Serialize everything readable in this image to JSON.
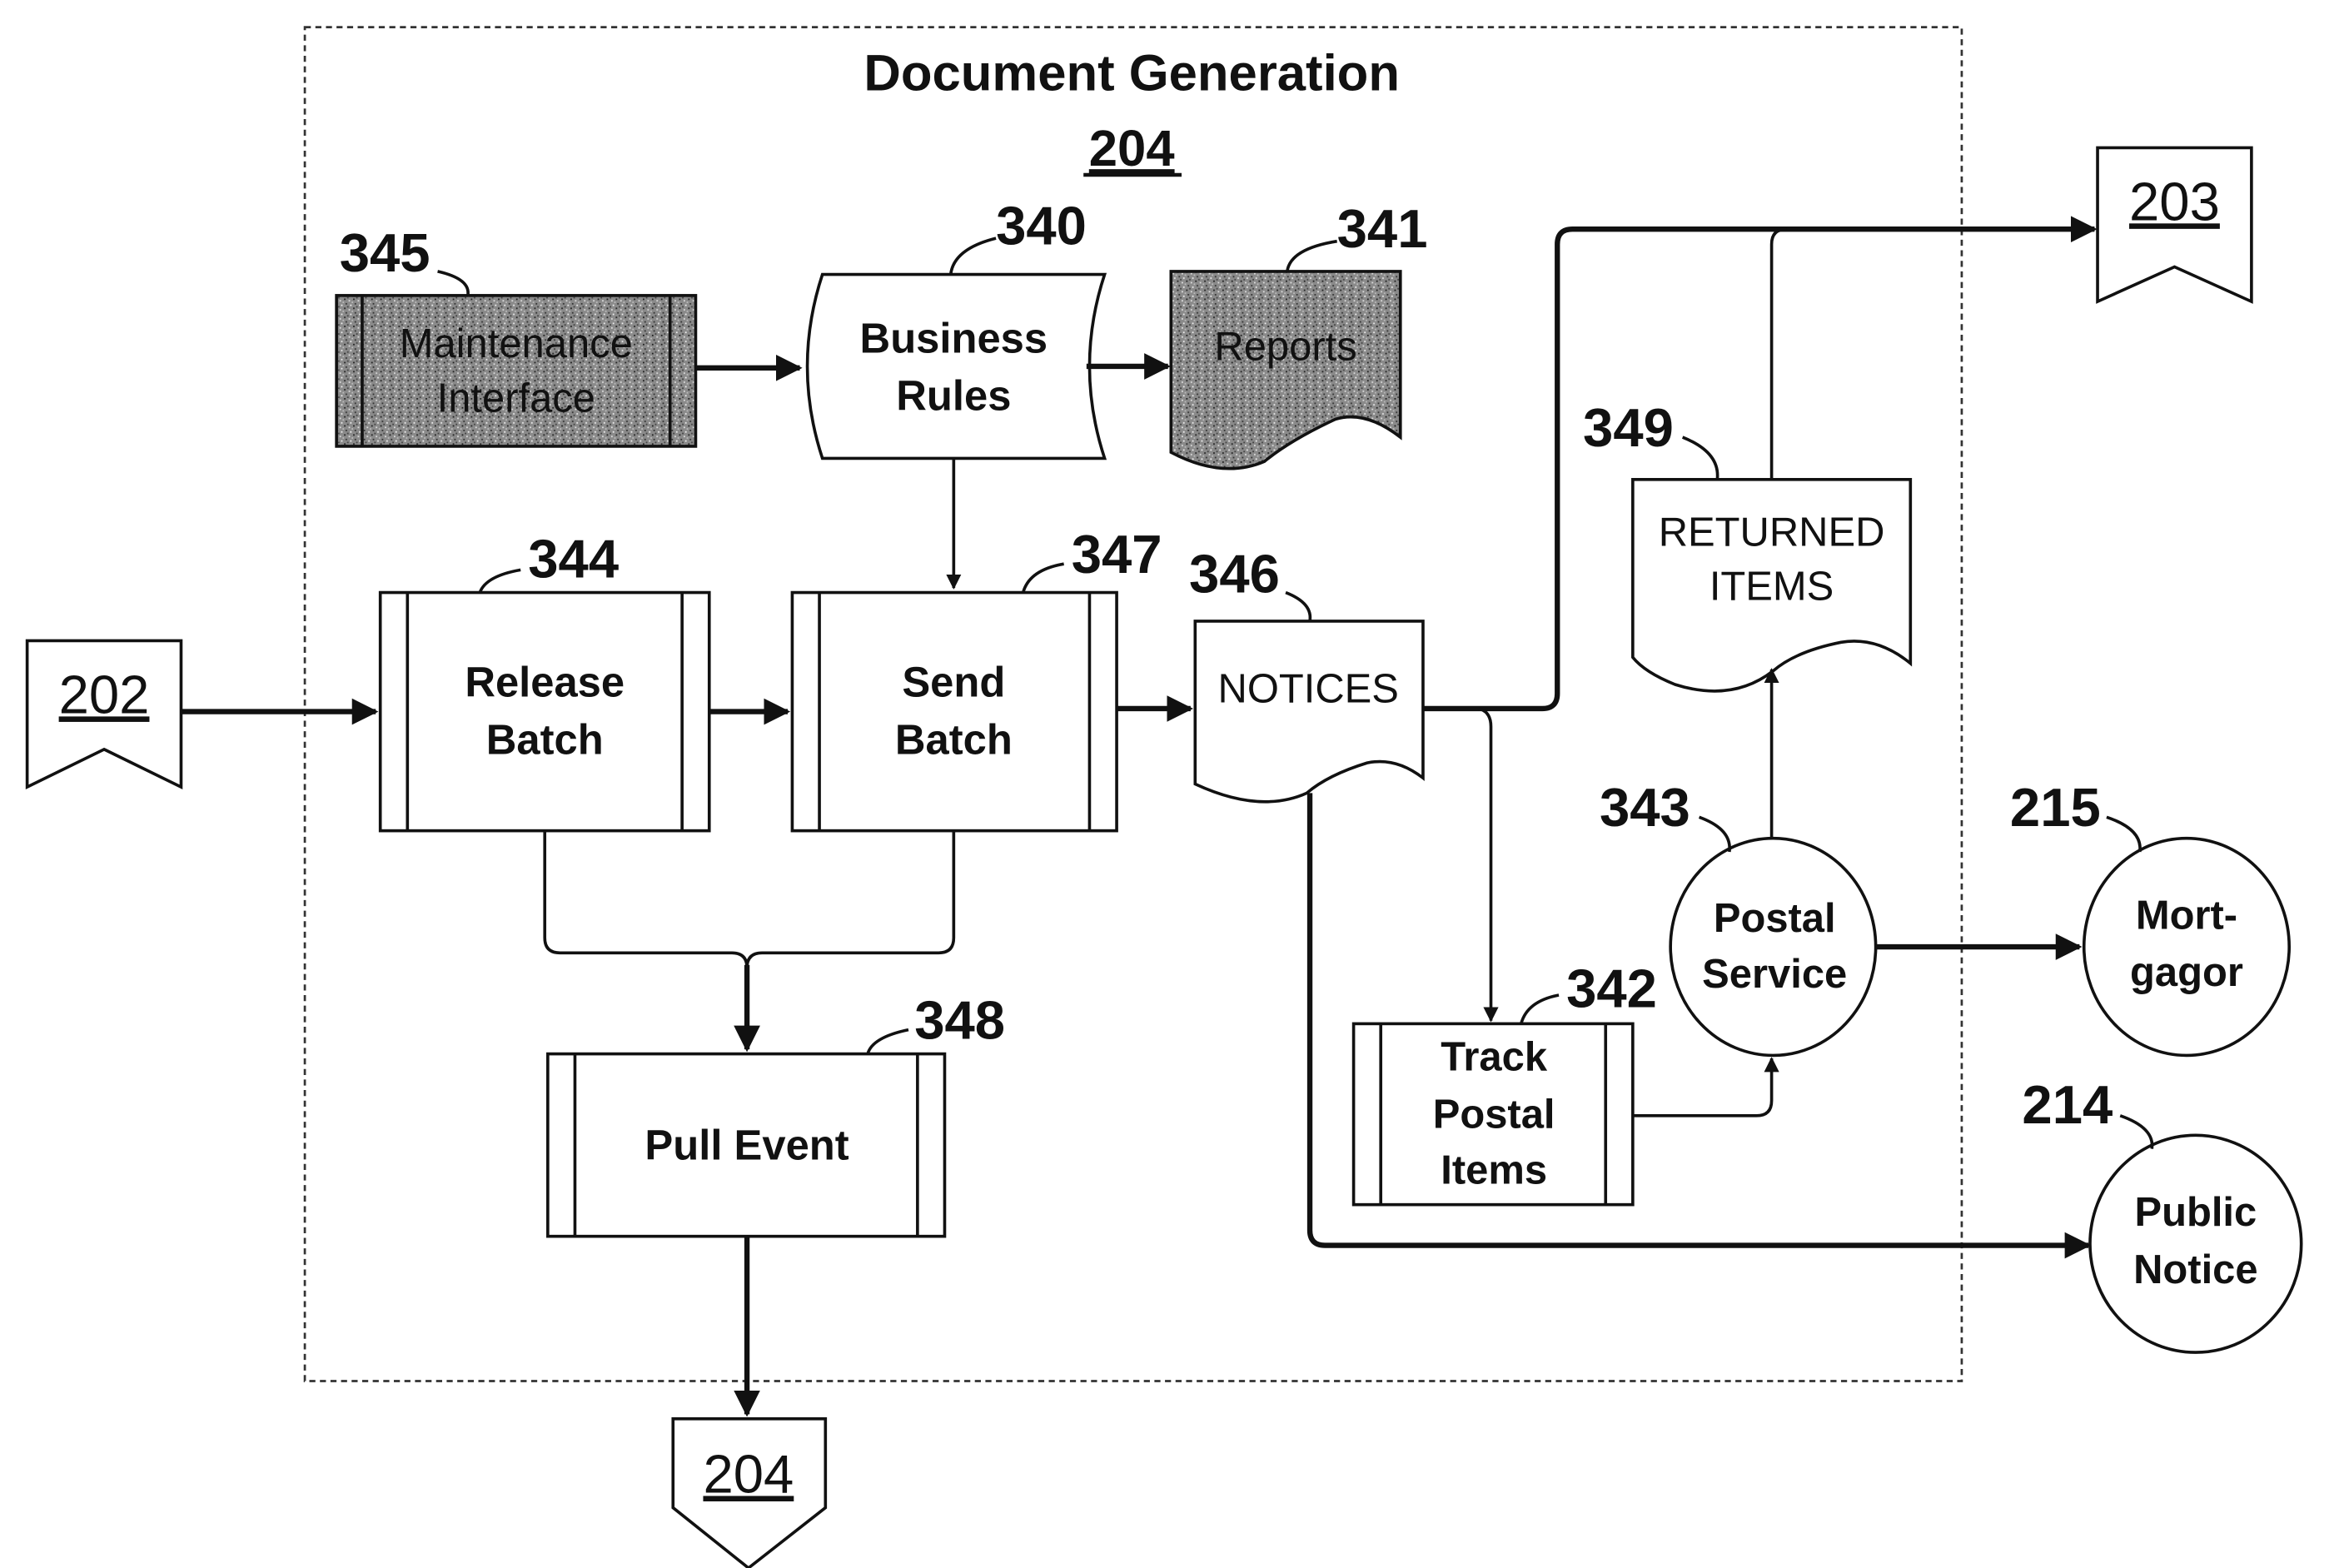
{
  "diagram": {
    "title": "Document Generation",
    "title_ref": "204",
    "connectors": {
      "in_202": "202",
      "out_203": "203",
      "out_204": "204"
    },
    "nodes": {
      "maintenance_interface": {
        "ref": "345",
        "line1": "Maintenance",
        "line2": "Interface"
      },
      "business_rules": {
        "ref": "340",
        "line1": "Business",
        "line2": "Rules"
      },
      "reports": {
        "ref": "341",
        "label": "Reports"
      },
      "release_batch": {
        "ref": "344",
        "line1": "Release",
        "line2": "Batch"
      },
      "send_batch": {
        "ref": "347",
        "line1": "Send",
        "line2": "Batch"
      },
      "notices": {
        "ref": "346",
        "label": "NOTICES"
      },
      "returned_items": {
        "ref": "349",
        "line1": "RETURNED",
        "line2": "ITEMS"
      },
      "pull_event": {
        "ref": "348",
        "label": "Pull Event"
      },
      "track_postal_items": {
        "ref": "342",
        "line1": "Track",
        "line2": "Postal",
        "line3": "Items"
      },
      "postal_service": {
        "ref": "343",
        "line1": "Postal",
        "line2": "Service"
      },
      "mortgagor": {
        "ref": "215",
        "line1": "Mort-",
        "line2": "gagor"
      },
      "public_notice": {
        "ref": "214",
        "line1": "Public",
        "line2": "Notice"
      }
    }
  }
}
